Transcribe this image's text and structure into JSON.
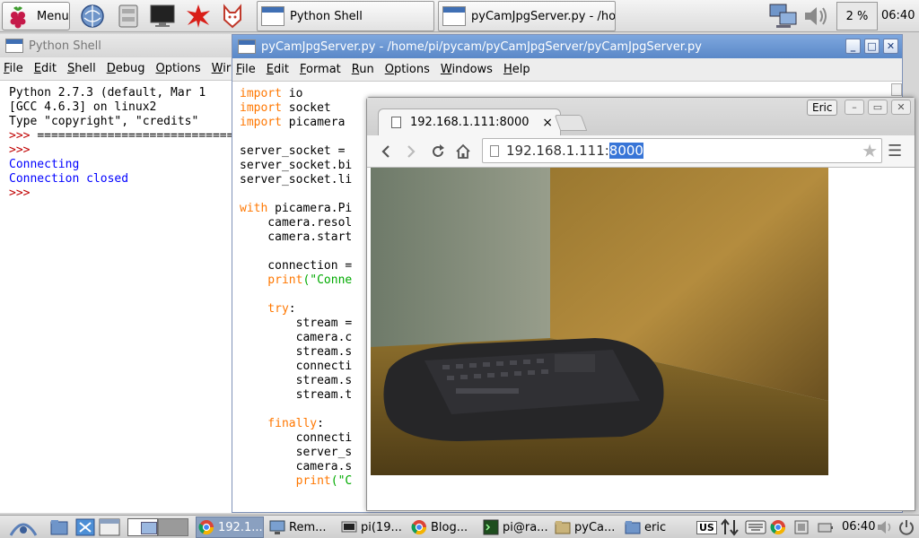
{
  "top_panel": {
    "menu_label": "Menu",
    "tasks": [
      {
        "label": "Python Shell"
      },
      {
        "label": "pyCamJpgServer.py - /hom..."
      }
    ],
    "cpu": "2 %",
    "clock": "06:40"
  },
  "shell": {
    "title": "Python Shell",
    "menu": [
      "File",
      "Edit",
      "Shell",
      "Debug",
      "Options",
      "Wir"
    ],
    "lines": [
      "Python 2.7.3 (default, Mar 1",
      "[GCC 4.6.3] on linux2",
      "Type \"copyright\", \"credits\"",
      "Connecting",
      "Connection closed"
    ],
    "prompt": ">>>",
    "restart": "=============================="
  },
  "editor": {
    "title": "pyCamJpgServer.py - /home/pi/pycam/pyCamJpgServer/pyCamJpgServer.py",
    "menu": [
      "File",
      "Edit",
      "Format",
      "Run",
      "Options",
      "Windows",
      "Help"
    ],
    "code": {
      "l1_kw": "import",
      "l1_rest": " io",
      "l2_kw": "import",
      "l2_rest": " socket",
      "l3_kw": "import",
      "l3_rest": " picamera",
      "l5": "server_socket =",
      "l6": "server_socket.bi",
      "l7": "server_socket.li",
      "l9_kw": "with",
      "l9_rest": " picamera.Pi",
      "l10": "    camera.resol",
      "l11": "    camera.start",
      "l13": "    connection =",
      "l14_kw": "    print",
      "l14_str": "(\"Conne",
      "l16_kw": "    try",
      "l16_rest": ":",
      "l17": "        stream =",
      "l18": "        camera.c",
      "l19": "        stream.s",
      "l20": "        connecti",
      "l21": "        stream.s",
      "l22": "        stream.t",
      "l24_kw": "    finally",
      "l24_rest": ":",
      "l25": "        connecti",
      "l26": "        server_s",
      "l27": "        camera.s",
      "l28_kw": "        print",
      "l28_str": "(\"C"
    }
  },
  "browser": {
    "tab_title": "192.168.1.111:8000",
    "profile": "Eric",
    "url_host": "192.168.1.111:",
    "url_port": "8000"
  },
  "bottom_panel": {
    "tasks": [
      {
        "label": "192.1..."
      },
      {
        "label": "Rem..."
      },
      {
        "label": "pi(19..."
      },
      {
        "label": "Blog..."
      },
      {
        "label": "pi@ra..."
      },
      {
        "label": "pyCa..."
      },
      {
        "label": "eric"
      }
    ],
    "keyboard_layout": "US",
    "clock": "06:40"
  },
  "colors": {
    "keyword": "#ff7700",
    "string": "#00aa00",
    "output": "#0000ff",
    "prompt": "#c00000",
    "active_title": "#5a88c8"
  }
}
